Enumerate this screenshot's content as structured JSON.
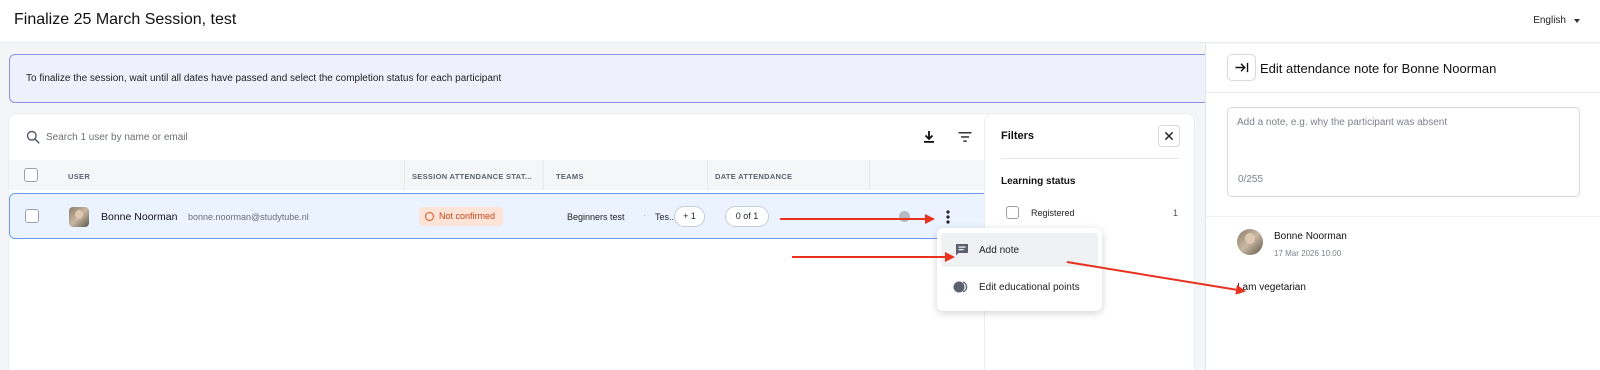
{
  "header": {
    "title": "Finalize 25 March Session, test",
    "language": "English"
  },
  "banner": {
    "text": "To finalize the session, wait until all dates have passed and select the completion status for each participant"
  },
  "search": {
    "placeholder": "Search 1 user by name or email"
  },
  "table": {
    "columns": [
      "USER",
      "SESSION ATTENDANCE STAT...",
      "TEAMS",
      "DATE ATTENDANCE"
    ],
    "rows": [
      {
        "name": "Bonne Noorman",
        "email": "bonne.noorman@studytube.nl",
        "status": "Not confirmed",
        "team_primary": "Beginners test",
        "team_secondary": "Tes...",
        "team_more": "+ 1",
        "date_attendance": "0 of 1"
      }
    ]
  },
  "filters": {
    "title": "Filters",
    "section": "Learning status",
    "options": [
      {
        "label": "Registered",
        "count": "1"
      }
    ]
  },
  "menu": {
    "items": [
      {
        "label": "Add note",
        "icon": "comment-icon"
      },
      {
        "label": "Edit educational points",
        "icon": "toggle-icon"
      }
    ]
  },
  "side_panel": {
    "title": "Edit attendance note for Bonne Noorman",
    "placeholder": "Add a note, e.g. why the participant was absent",
    "char_count": "0/255",
    "note": {
      "author": "Bonne Noorman",
      "timestamp": "17 Mar 2026 10:00",
      "text": "I am vegetarian"
    }
  },
  "colors": {
    "accent": "#6d9be8",
    "banner_border": "#8e93e8",
    "status_text": "#c4461a",
    "status_bg": "#fde4d6",
    "annotation_arrow": "#e8321f"
  }
}
